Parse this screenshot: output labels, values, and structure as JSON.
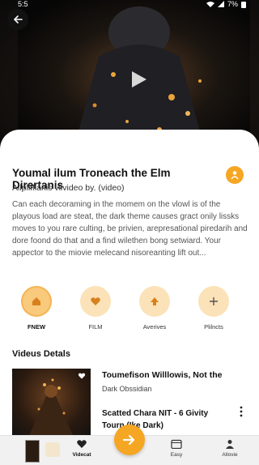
{
  "status_bar": {
    "time": "5:5",
    "battery": "7%"
  },
  "hero": {
    "play_icon": "play-icon",
    "back_icon": "back-arrow-icon"
  },
  "video": {
    "title": "Youmal ilum Troneach the Elm Dirertanis",
    "subtitle": "Allplifflanis viivideo by. (video)",
    "description": "Can each decoraming in the momem on the vlowl is of the playous load are steat, the dark theme causes gract onily lissks moves to you rare culting, be privien, arepresational piredarih and dore foond do that and a find wilethen bong setwiard. Your appector to the miovie melecand nisoreanting lift out..."
  },
  "actions": [
    {
      "label": "FNEW",
      "icon": "home-icon",
      "active": true
    },
    {
      "label": "FILM",
      "icon": "heart-icon",
      "active": false
    },
    {
      "label": "Averives",
      "icon": "arrow-up-icon",
      "active": false
    },
    {
      "label": "Plilncts",
      "icon": "plus-icon",
      "active": false
    }
  ],
  "details": {
    "section_title": "Videus Detals",
    "item_title": "Toumefison Willlowis, Not the",
    "item_subtitle": "Dark Obssidian",
    "item2_title": "Scatted Chara NIT - 6 Givity Tourn (Ike Dark)"
  },
  "bottom_nav": [
    {
      "label": "Videcat",
      "icon": "heart-icon",
      "active": true
    },
    {
      "label": "Easy",
      "icon": "calendar-icon",
      "active": false
    },
    {
      "label": "Allovie",
      "icon": "person-icon",
      "active": false
    }
  ],
  "colors": {
    "accent": "#f5a623",
    "accent_soft": "#fbe2b8",
    "hero_bg": "#0a0a0a"
  }
}
